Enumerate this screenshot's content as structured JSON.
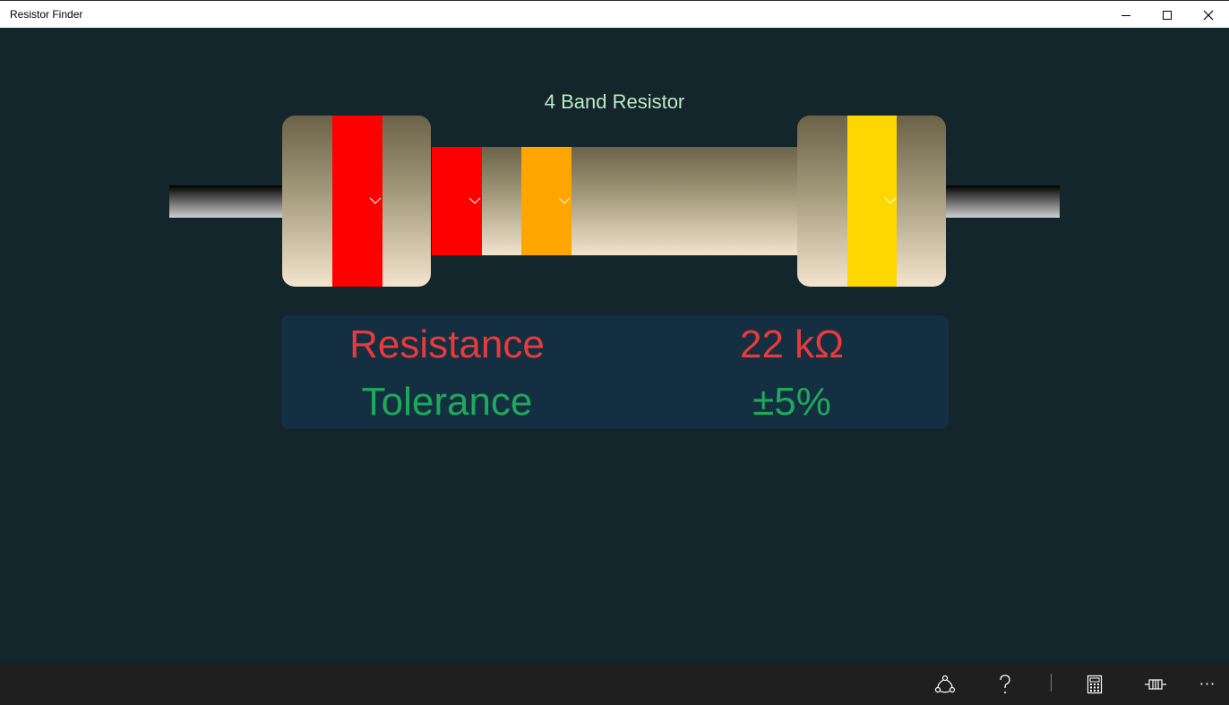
{
  "window": {
    "title": "Resistor Finder"
  },
  "resistor": {
    "heading": "4 Band Resistor",
    "bands": [
      {
        "name": "first-digit",
        "color": "#ff0000"
      },
      {
        "name": "second-digit",
        "color": "#ff0000"
      },
      {
        "name": "multiplier",
        "color": "#ffa500"
      },
      {
        "name": "tolerance",
        "color": "#ffd700"
      }
    ]
  },
  "result": {
    "resistance_label": "Resistance",
    "resistance_value": "22 kΩ",
    "tolerance_label": "Tolerance",
    "tolerance_value": "±5%",
    "resistance_color": "#e83a3a",
    "tolerance_color": "#1fa85a"
  },
  "appbar": {
    "buttons": [
      "share-icon",
      "help-icon",
      "calculator-icon",
      "resistor-icon",
      "more-icon"
    ],
    "more_label": "···"
  }
}
